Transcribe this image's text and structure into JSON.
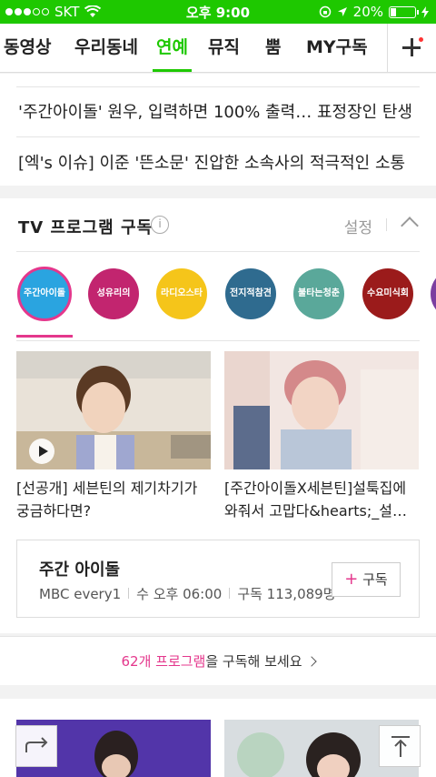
{
  "status_bar": {
    "carrier": "SKT",
    "time": "오후 9:00",
    "battery": "20%"
  },
  "tabs": [
    {
      "label": "동영상"
    },
    {
      "label": "우리동네"
    },
    {
      "label": "연예",
      "active": true
    },
    {
      "label": "뮤직"
    },
    {
      "label": "뿜"
    },
    {
      "label": "MY구독"
    }
  ],
  "headlines": [
    "'주간아이돌' 원우, 입력하면 100% 출력… 표정장인 탄생",
    "[엑's 이슈] 이준 '뜬소문' 진압한 소속사의 적극적인 소통"
  ],
  "tv_section": {
    "title": "TV 프로그램 구독",
    "info_label": "i",
    "settings_label": "설정",
    "programs": [
      {
        "logo_text": "주간아이돌",
        "color": "#2aa4e0",
        "selected": true
      },
      {
        "logo_text": "성유리의",
        "color": "#c2256f"
      },
      {
        "logo_text": "라디오스타",
        "color": "#f5c51a"
      },
      {
        "logo_text": "전지적참견",
        "color": "#2f6b8f"
      },
      {
        "logo_text": "불타는청춘",
        "color": "#5aa89a"
      },
      {
        "logo_text": "수요미식회",
        "color": "#9b1b1b"
      },
      {
        "logo_text": "",
        "color": "#7b3fa0"
      }
    ],
    "clips": [
      {
        "caption": "[선공개] 세븐틴의 제기차기가 궁금하다면?",
        "has_play": true
      },
      {
        "caption": "[주간아이돌X세븐틴]설툭집에 와줘서 고맙다&hearts;_설…",
        "has_play": false
      }
    ],
    "featured": {
      "name": "주간 아이돌",
      "channel": "MBC every1",
      "schedule": "수 오후 06:00",
      "subscribers": "구독 113,089명",
      "subscribe_label": "구독",
      "subscribe_plus": "+"
    },
    "more": {
      "count_text": "62개 프로그램",
      "suffix": "을 구독해 보세요"
    }
  }
}
